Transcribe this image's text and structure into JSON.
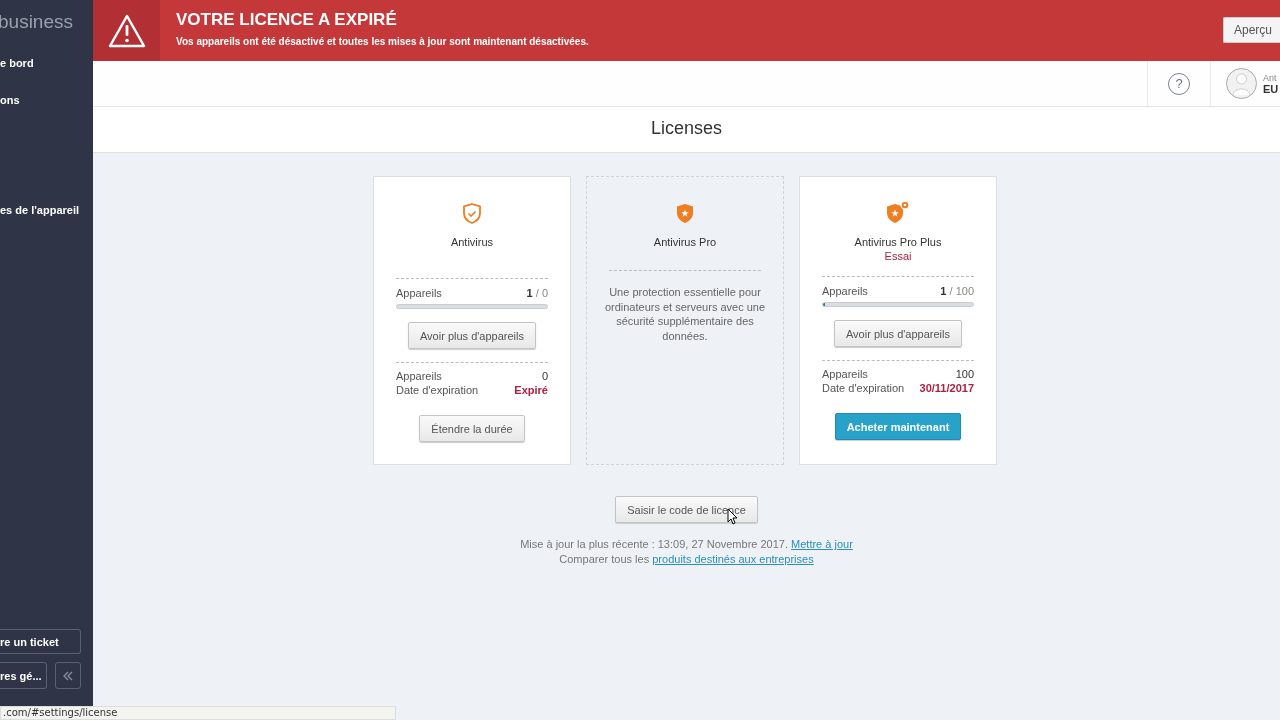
{
  "sidebar": {
    "brand": "business",
    "items": [
      {
        "label": "e bord"
      },
      {
        "label": "ons"
      },
      {
        "label": "es de l'appareil"
      }
    ],
    "ticket_button": "re un ticket",
    "settings_button": "res gé..."
  },
  "banner": {
    "title": "VOTRE LICENCE A EXPIRÉ",
    "message": "Vos appareils ont été désactivé et toutes les mises à jour sont maintenant désactivées.",
    "button": "Aperçu"
  },
  "topbar": {
    "help": "?",
    "user_line": "Ant",
    "user_name": "EU"
  },
  "page_title": "Licenses",
  "cards": [
    {
      "kind": "license",
      "name": "Antivirus",
      "devices_label": "Appareils",
      "used": "1",
      "total": "/ 0",
      "level": 0,
      "upgrade_button": "Avoir plus d'appareils",
      "summary": [
        {
          "label": "Appareils",
          "value": "0",
          "alert": false
        },
        {
          "label": "Date d'expiration",
          "value": "Expiré",
          "alert": true
        }
      ],
      "action": {
        "label": "Étendre la durée",
        "primary": false
      }
    },
    {
      "kind": "promo",
      "name": "Antivirus Pro",
      "description": "Une protection essentielle pour ordinateurs et serveurs avec une sécurité supplémentaire des données."
    },
    {
      "kind": "license",
      "name": "Antivirus Pro Plus",
      "status": "Essai",
      "devices_label": "Appareils",
      "used": "1",
      "total": "/ 100",
      "level": 0.01,
      "upgrade_button": "Avoir plus d'appareils",
      "summary": [
        {
          "label": "Appareils",
          "value": "100",
          "alert": false
        },
        {
          "label": "Date d'expiration",
          "value": "30/11/2017",
          "alert": true
        }
      ],
      "action": {
        "label": "Acheter maintenant",
        "primary": true
      }
    }
  ],
  "license_code_button": "Saisir le code de licence",
  "update_text": "Mise à jour la plus récente : 13:09, 27 Novembre 2017.",
  "update_link": "Mettre à jour",
  "compare_text": "Comparer tous les",
  "compare_link": "produits destinés aux entreprises",
  "status_url": ".com/#settings/license"
}
